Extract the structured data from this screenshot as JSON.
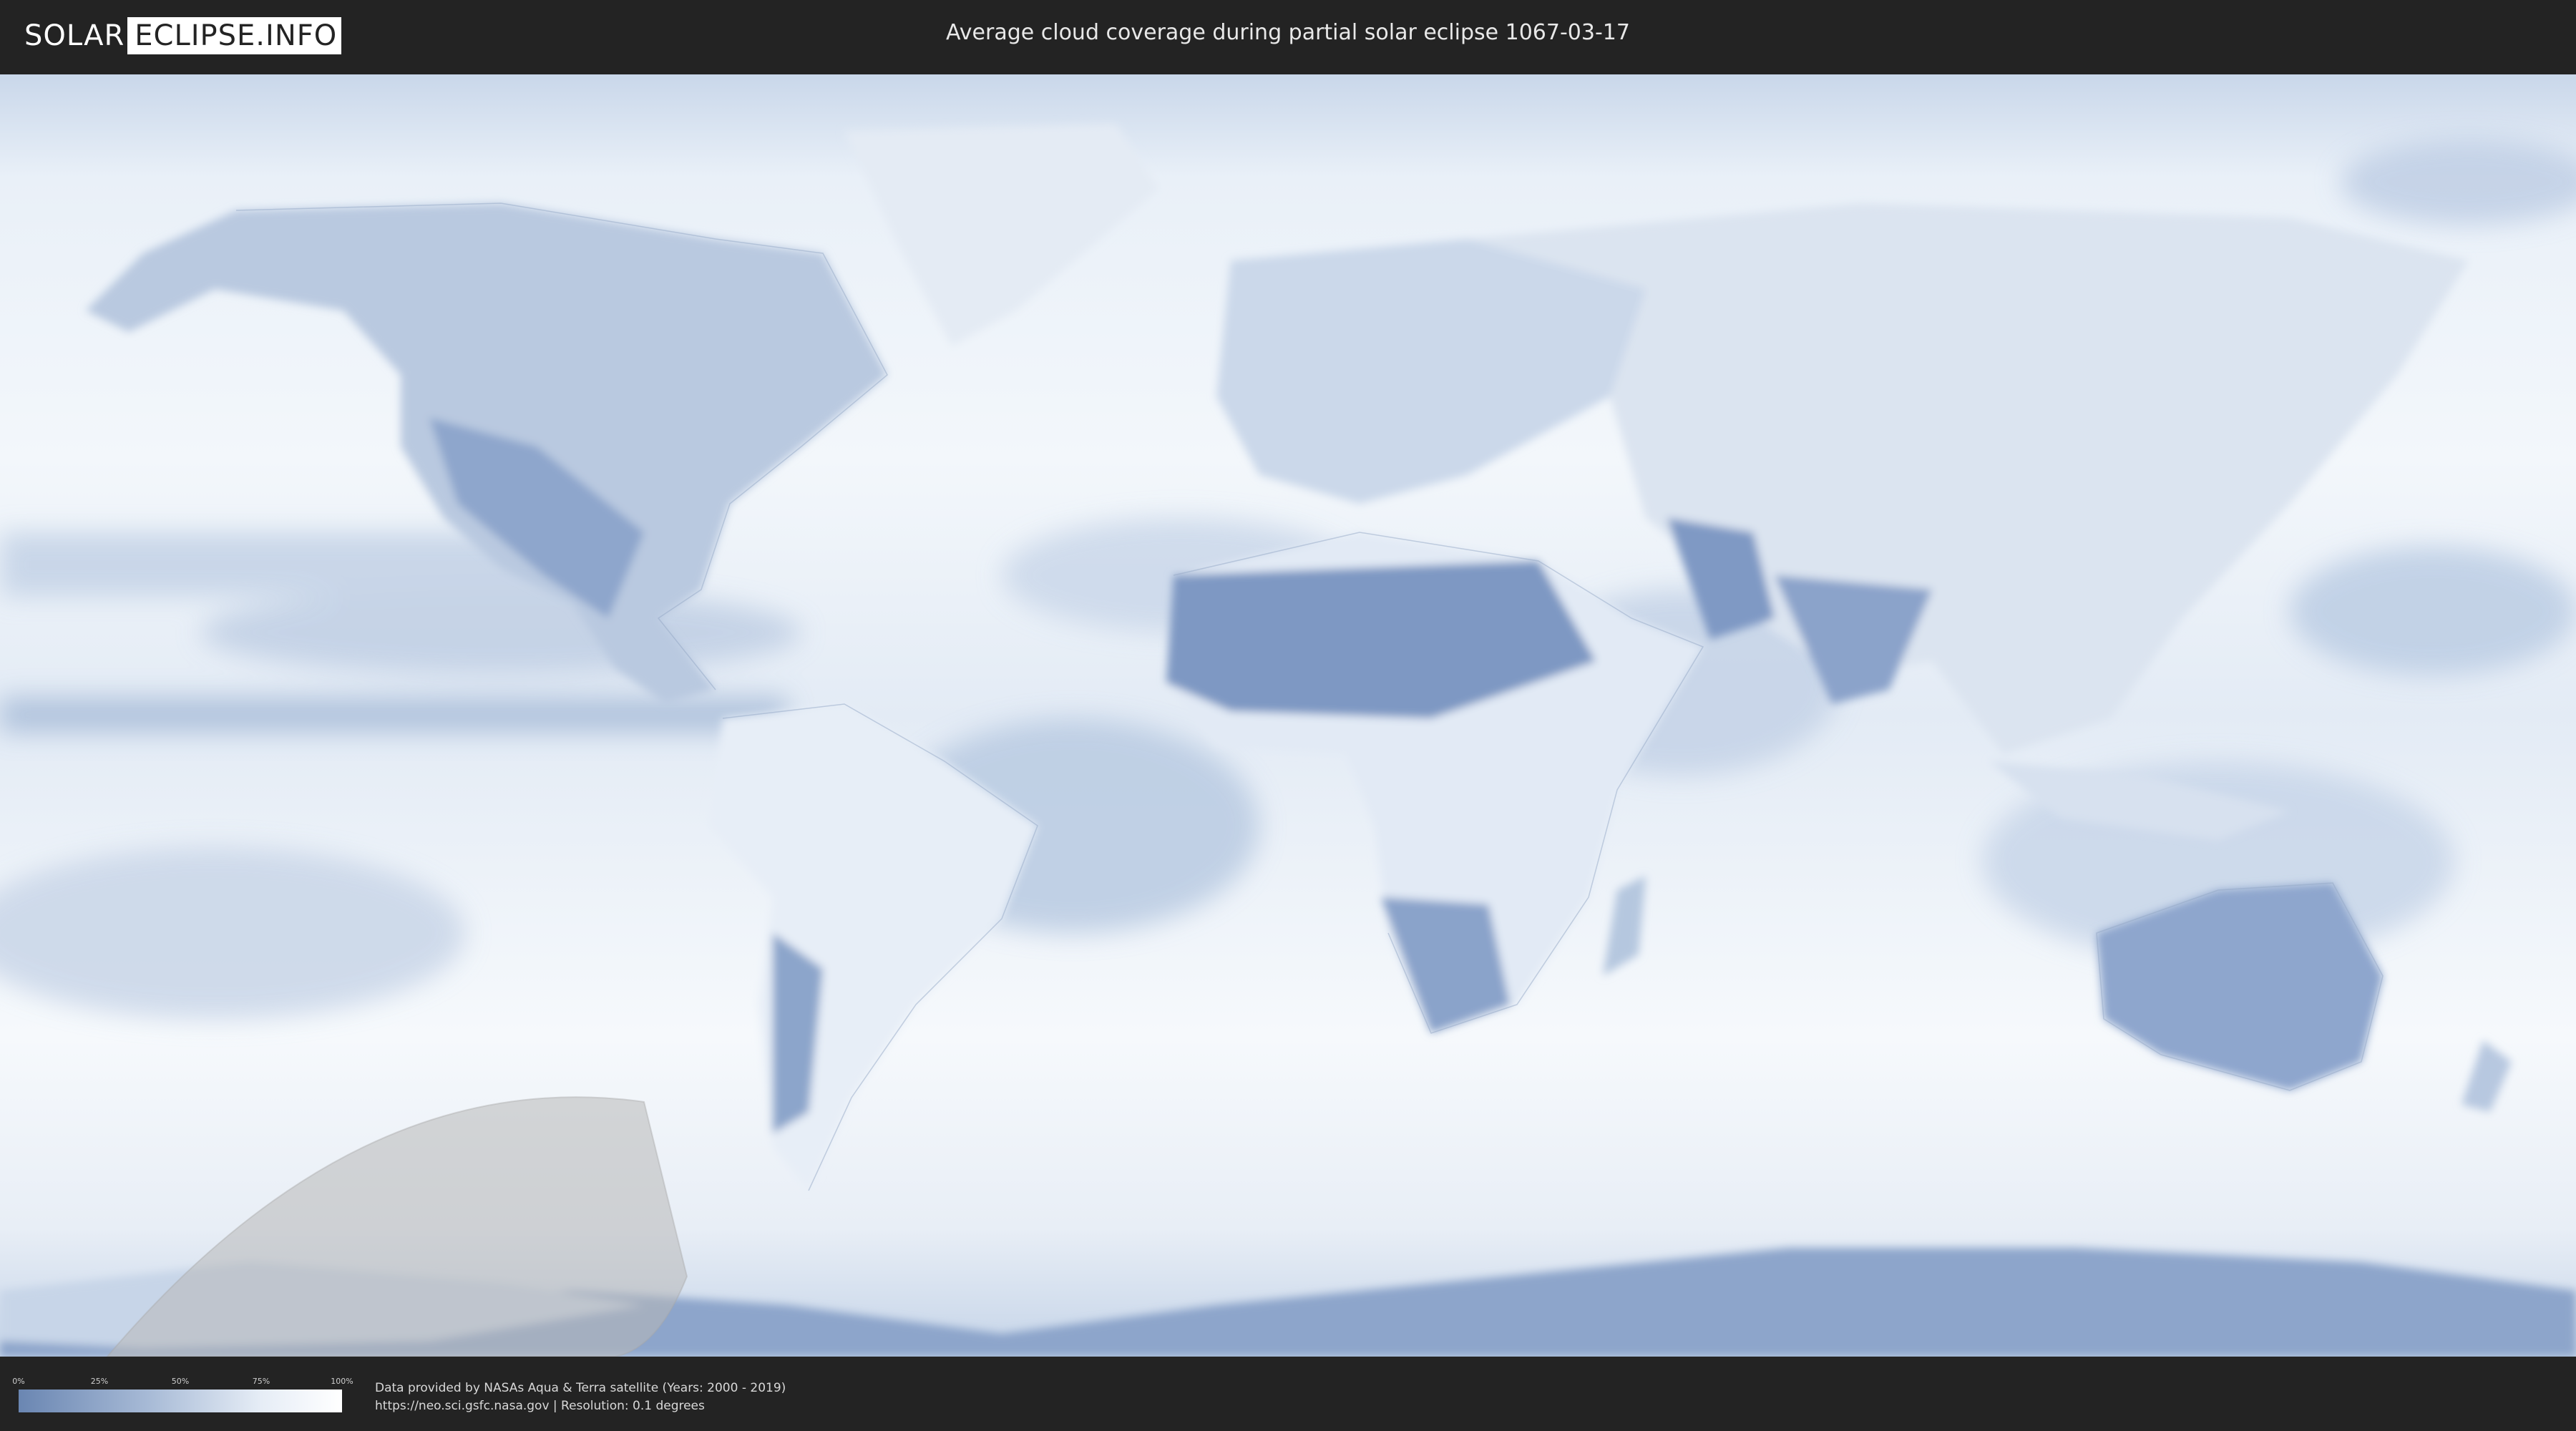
{
  "header": {
    "logo_left": "SOLAR",
    "logo_right": "ECLIPSE.INFO",
    "title": "Average cloud coverage during partial solar eclipse 1067-03-17"
  },
  "legend": {
    "ticks": [
      "0%",
      "25%",
      "50%",
      "75%",
      "100%"
    ],
    "color_low": "#6a86b2",
    "color_high": "#ffffff"
  },
  "credits": {
    "line1": "Data provided by NASAs Aqua & Terra satellite (Years: 2000 - 2019)",
    "line2": "https://neo.sci.gsfc.nasa.gov | Resolution: 0.1 degrees"
  },
  "map": {
    "ocean_color": "#eef3f9",
    "clear_sky_color": "#7c97c2",
    "eclipse_zone_color": "#b8b8b8"
  }
}
